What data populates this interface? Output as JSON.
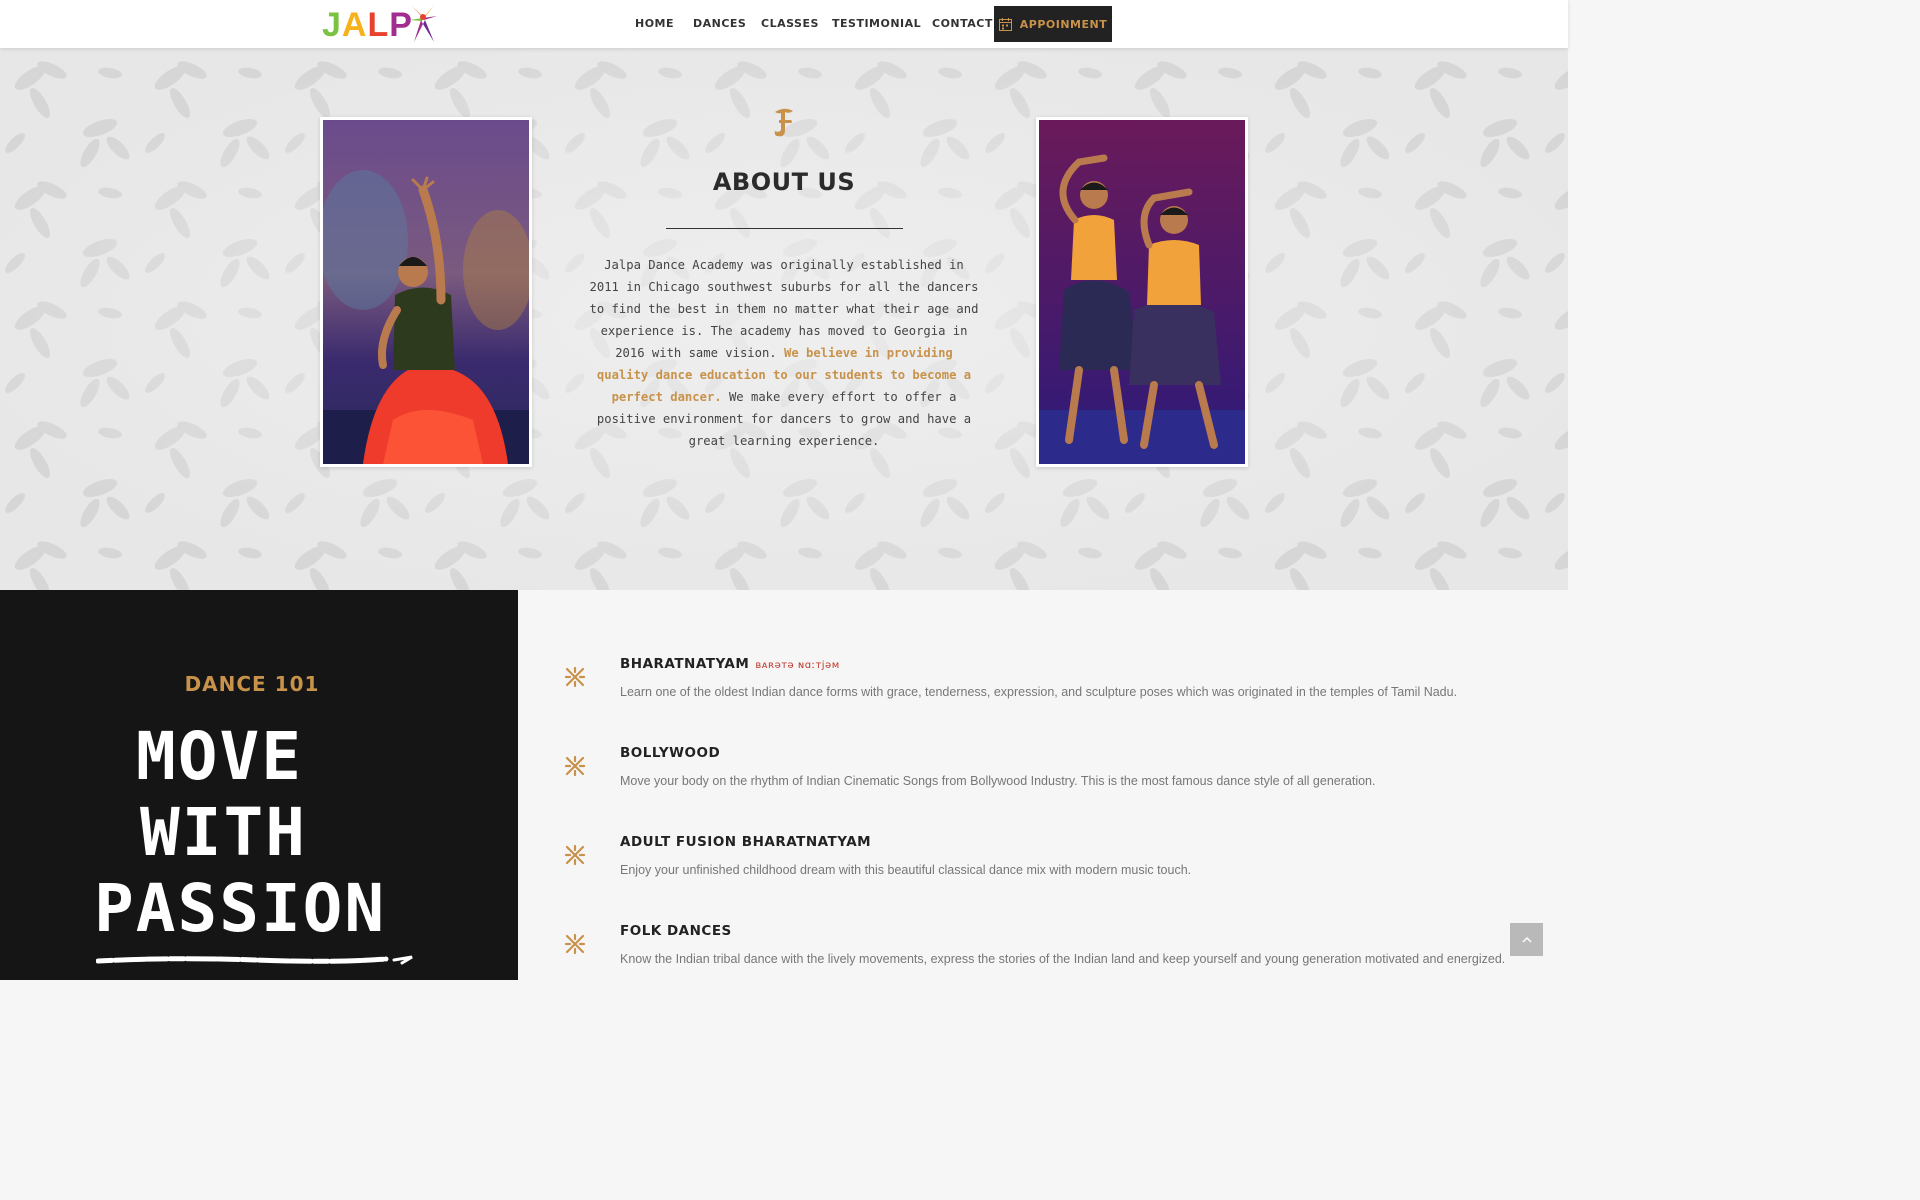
{
  "brand": {
    "logo_alt": "JALPA",
    "letters": [
      "J",
      "A",
      "L",
      "P"
    ]
  },
  "nav": {
    "items": [
      "HOME",
      "DANCES",
      "CLASSES",
      "TESTIMONIAL",
      "CONTACT"
    ],
    "appointment_label": "APPOINMENT"
  },
  "about": {
    "title": "ABOUT US",
    "text_before": "Jalpa Dance Academy was originally established in 2011 in Chicago southwest suburbs for all the dancers to find the best in them no matter what their age and experience is. The academy has moved to Georgia in 2016 with same vision.",
    "text_highlight": "We believe in providing quality dance education to our students to become a perfect dancer.",
    "text_after": "We make every effort to offer a positive environment for dancers to grow and have a great learning experience."
  },
  "dance101": {
    "title": "DANCE 101",
    "slogan_lines": [
      "MOVE",
      "WITH",
      "PASSION"
    ],
    "items": [
      {
        "name": "BHARATNATYAM",
        "phonetic": "ʙᴀʀəᴛə ɴɑːᴛjəᴍ",
        "desc": "Learn one of the oldest Indian dance forms with grace, tenderness, expression, and sculpture poses which was originated in the temples of Tamil Nadu."
      },
      {
        "name": "BOLLYWOOD",
        "phonetic": "",
        "desc": "Move your body on the rhythm of Indian Cinematic Songs from Bollywood Industry. This is the most famous dance style of all generation."
      },
      {
        "name": "ADULT FUSION BHARATNATYAM",
        "phonetic": "",
        "desc": "Enjoy your unfinished childhood dream with this beautiful classical dance mix with modern music touch."
      },
      {
        "name": "FOLK DANCES",
        "phonetic": "",
        "desc": "Know the Indian tribal dance with the lively movements, express the stories of the Indian land and keep yourself and young generation motivated and energized."
      }
    ]
  },
  "colors": {
    "accent": "#c8924a",
    "dark": "#151515",
    "phonetic": "#c0392b"
  },
  "icons": {
    "scroll_top": "chevron-up-icon",
    "calendar": "calendar-icon",
    "list_bullet": "ornament-icon"
  }
}
